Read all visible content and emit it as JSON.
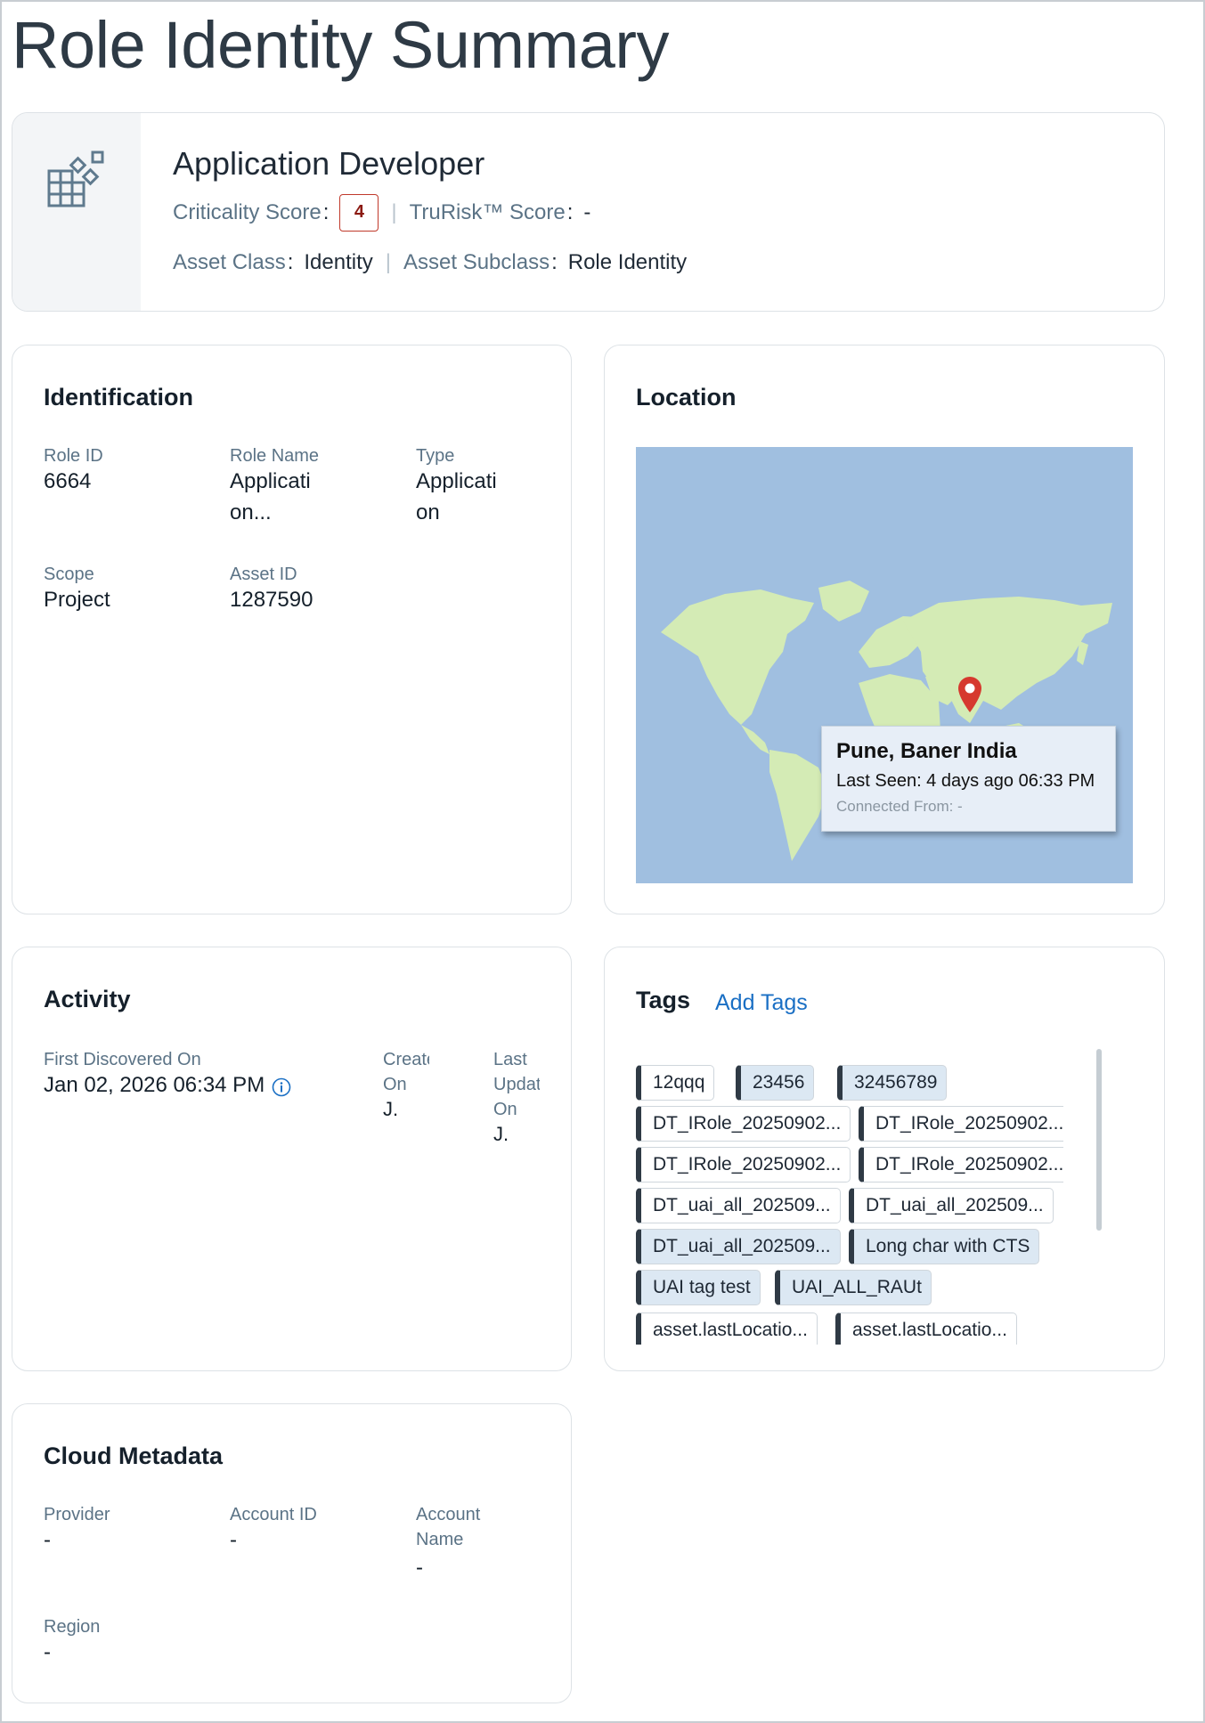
{
  "page_title": "Role Identity Summary",
  "header": {
    "name": "Application Developer",
    "criticality_label": "Criticality Score",
    "criticality_value": "4",
    "trurisk_label": "TruRisk™ Score",
    "trurisk_value": "-",
    "asset_class_label": "Asset Class",
    "asset_class_value": "Identity",
    "asset_subclass_label": "Asset Subclass",
    "asset_subclass_value": "Role Identity",
    "icon": "asset-grid-icon"
  },
  "identification": {
    "title": "Identification",
    "role_id_label": "Role ID",
    "role_id_value": "6664",
    "role_name_label": "Role Name",
    "role_name_line1": "Applicati",
    "role_name_line2": "on...",
    "type_label": "Type",
    "type_line1": "Applicati",
    "type_line2": "on",
    "scope_label": "Scope",
    "scope_value": "Project",
    "asset_id_label": "Asset ID",
    "asset_id_value": "1287590"
  },
  "location": {
    "title": "Location",
    "place": "Pune, Baner India",
    "last_seen": "Last Seen: 4 days ago 06:33 PM",
    "connected_from": "Connected From: -",
    "pin_color": "#d6392e",
    "land_color": "#d4ebb5",
    "water_color": "#a0bfe0"
  },
  "activity": {
    "title": "Activity",
    "first_discovered_label": "First Discovered On",
    "first_discovered_value": "Jan 02, 2026 06:34 PM",
    "created_label_1": "Create",
    "created_label_2": "On",
    "created_value": "J.",
    "updated_label_1": "Last",
    "updated_label_2": "Updat",
    "updated_label_3": "On",
    "updated_value": "J."
  },
  "tags": {
    "title": "Tags",
    "add_label": "Add Tags",
    "items": [
      {
        "label": "12qqq",
        "highlight": false
      },
      {
        "label": "23456",
        "highlight": true
      },
      {
        "label": "32456789",
        "highlight": true
      },
      {
        "label": "DT_IRole_20250902...",
        "highlight": false
      },
      {
        "label": "DT_IRole_20250902...",
        "highlight": false
      },
      {
        "label": "DT_IRole_20250902...",
        "highlight": false
      },
      {
        "label": "DT_IRole_20250902...",
        "highlight": false
      },
      {
        "label": "DT_uai_all_202509...",
        "highlight": false
      },
      {
        "label": "DT_uai_all_202509...",
        "highlight": false
      },
      {
        "label": "DT_uai_all_202509...",
        "highlight": true
      },
      {
        "label": "Long char with CTS",
        "highlight": true
      },
      {
        "label": "UAI tag test",
        "highlight": true
      },
      {
        "label": "UAI_ALL_RAUt",
        "highlight": true
      },
      {
        "label": "asset.lastLocatio...",
        "highlight": false
      },
      {
        "label": "asset.lastLocatio...",
        "highlight": false
      }
    ]
  },
  "cloud": {
    "title": "Cloud Metadata",
    "provider_label": "Provider",
    "provider_value": "-",
    "account_id_label": "Account ID",
    "account_id_value": "-",
    "account_name_label_1": "Account",
    "account_name_label_2": "Name",
    "account_name_value": "-",
    "region_label": "Region",
    "region_value": "-"
  }
}
